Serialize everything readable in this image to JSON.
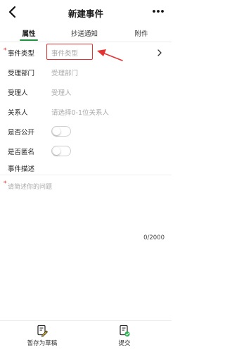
{
  "nav": {
    "title": "新建事件"
  },
  "tabs": [
    {
      "label": "属性",
      "active": true
    },
    {
      "label": "抄送通知",
      "active": false
    },
    {
      "label": "附件",
      "active": false
    }
  ],
  "form": {
    "event_type": {
      "label": "事件类型",
      "required": true,
      "placeholder": "事件类型"
    },
    "department": {
      "label": "受理部门",
      "placeholder": "受理部门"
    },
    "assignee": {
      "label": "受理人",
      "placeholder": "受理人"
    },
    "contact": {
      "label": "关系人",
      "placeholder": "请选择0-1位关系人"
    },
    "is_public": {
      "label": "是否公开",
      "on": false
    },
    "is_anonymous": {
      "label": "是否匿名",
      "on": false
    },
    "description": {
      "heading": "事件描述",
      "placeholder": "请简述你的问题",
      "counter": "0/2000"
    }
  },
  "footer": {
    "save_draft": "暂存为草稿",
    "submit": "提交"
  },
  "colors": {
    "accent": "#1f9140",
    "required": "#d9302c",
    "annotation": "#e53232"
  }
}
